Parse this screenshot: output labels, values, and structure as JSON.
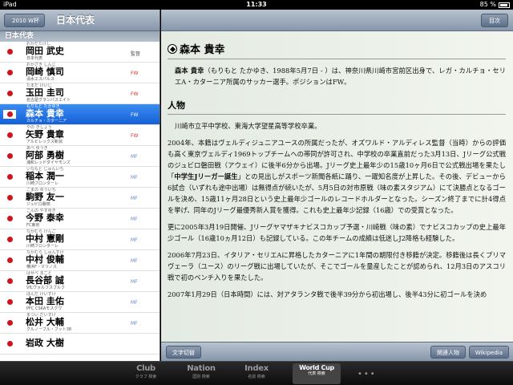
{
  "status_bar": {
    "carrier": "iPad",
    "time": "11:33",
    "battery": "85 %"
  },
  "left_pane": {
    "back_label": "2010 W杯",
    "title": "日本代表",
    "section": "日本代表",
    "players": [
      {
        "kana": "おかだたけし",
        "name": "岡田 武史",
        "club": "日本代表",
        "pos": "監督"
      },
      {
        "kana": "おかざき しんじ",
        "name": "岡崎 慎司",
        "club": "清水エスパルス",
        "pos": "FW"
      },
      {
        "kana": "たまだ けいじ",
        "name": "玉田 圭司",
        "club": "名古屋グランパスエイト",
        "pos": "FW"
      },
      {
        "kana": "もりもと たかゆき",
        "name": "森本 貴幸",
        "club": "カルチョ・カターニア",
        "pos": "FW"
      },
      {
        "kana": "やの きしょう",
        "name": "矢野 貴章",
        "club": "アルビレックス新潟",
        "pos": "FW"
      },
      {
        "kana": "あべ ゆうき",
        "name": "阿部 勇樹",
        "club": "浦和レッドダイヤモンズ",
        "pos": "MF"
      },
      {
        "kana": "いなもと じゅんいち",
        "name": "稲本 潤一",
        "club": "川崎フロンターレ",
        "pos": "MF"
      },
      {
        "kana": "こまの ゆういち",
        "name": "駒野 友一",
        "club": "ジュビロ磐田",
        "pos": "MF"
      },
      {
        "kana": "こんの やすゆき",
        "name": "今野 泰幸",
        "club": "FC東京",
        "pos": "MF"
      },
      {
        "kana": "なかむら けんご",
        "name": "中村 憲剛",
        "club": "川崎フロンターレ",
        "pos": "MF"
      },
      {
        "kana": "なかむら しゅんすけ",
        "name": "中村 俊輔",
        "club": "横浜F・マリノス",
        "pos": "MF"
      },
      {
        "kana": "はせべ まこと",
        "name": "長谷部 誠",
        "club": "VfLヴォルフスブルク",
        "pos": "MF"
      },
      {
        "kana": "ほんだ けいすけ",
        "name": "本田 圭佑",
        "club": "PFC CSKAモスクワ",
        "pos": "MF"
      },
      {
        "kana": "まつい だいすけ",
        "name": "松井 大輔",
        "club": "グルノーブル・フット38",
        "pos": "MF"
      },
      {
        "kana": "",
        "name": "岩政 大樹",
        "club": "",
        "pos": ""
      }
    ]
  },
  "right_pane": {
    "toc_label": "目次",
    "title": "森本 貴幸",
    "intro_bold": "森本 貴幸",
    "intro_rest": "（もりもと たかゆき、1988年5月7日 - ）は、神奈川県川崎市宮前区出身で、レガ・カルチョ・セリエA・カターニア所属のサッカー選手。ポジションはFW。",
    "section_heading": "人物",
    "para1": "川崎市立平中学校、東海大学望星高等学校卒業。",
    "para2_a": "2004年、本籍はヴェルディジュニアユースの所属だったが、オズワルド・アルディレス監督（当時）からの評価も高く東京ヴェルディ1969トップチームへの帯同が許可され、中学校の卒業直前だった3月13日、Jリーグ公式戦のジュビロ磐田戦（アウェイ）に後半6分から出場。Jリーグ史上最年少の15歳10ヶ月6日で公式戦出場を果たし「",
    "para2_bold": "中学生Jリーガー誕生",
    "para2_b": "」との見出しがスポーツ新聞各紙に踊り、一躍知名度が上昇した。その後、デビューから6試合（いずれも途中出場）は無得点が続いたが、5月5日の対市原戦（味の素スタジアム）にて決勝点となるゴールを決め、15歳11ヶ月28日という史上最年少ゴールのレコードホルダーとなった。シーズン終了までに計4得点を挙げ、同年のJリーグ最優秀新人賞を獲得。これも史上最年少記録（16歳）での受賞となった。",
    "para3": "更に2005年3月19日開催、Jリーグヤマザキナビスコカップ予選・川崎戦（味の素）でナビスコカップの史上最年少ゴール（16歳10ヵ月12日）も記録している。この年チームの成績は低迷しJ2降格も経験した。",
    "para4": "2006年7月23日、イタリア・セリエAに昇格したカターニアに1年間の期限付き移籍が決定。移籍後は長くプリマヴェーラ（ユース）のリーグ戦に出場していたが、そこでゴールを量産したことが認められ、12月3日のアスコリ戦で初のベンチ入りを果たした。",
    "para5": "2007年1月29日（日本時間）には、対アタランタ戦で後半39分から初出場し、後半43分に初ゴールを決め",
    "btn_text_size": "文字切替",
    "btn_related": "関連人物",
    "btn_wikipedia": "Wikipedia"
  },
  "tab_bar": {
    "tabs": [
      {
        "big": "Club",
        "small": "クラブ 検索"
      },
      {
        "big": "Nation",
        "small": "国別 検索"
      },
      {
        "big": "Index",
        "small": "名前 検索"
      },
      {
        "big": "World Cup",
        "small": "代表 検索"
      }
    ],
    "more": "•••"
  }
}
